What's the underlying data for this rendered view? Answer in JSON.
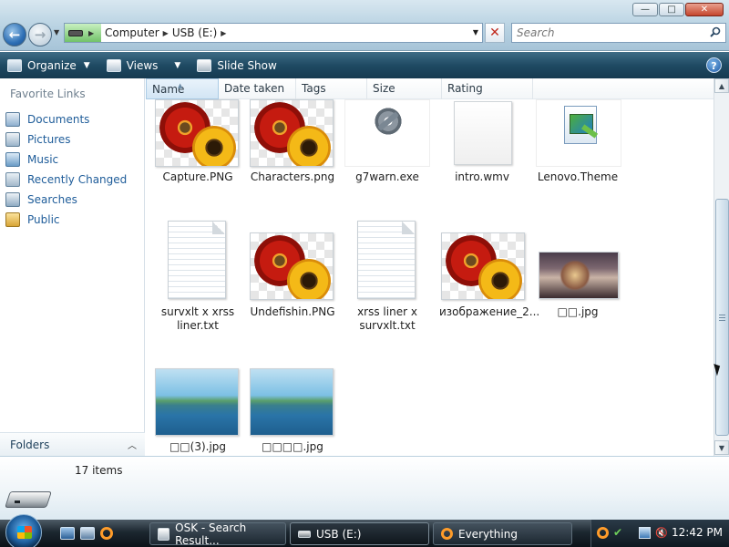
{
  "window": {
    "minimize_label": "—",
    "maximize_label": "□",
    "close_label": "✕"
  },
  "nav": {
    "back_label": "←",
    "forward_label": "→",
    "breadcrumbs": [
      "Computer",
      "USB (E:)"
    ],
    "search_placeholder": "Search"
  },
  "toolbar": {
    "organize_label": "Organize",
    "views_label": "Views",
    "slideshow_label": "Slide Show",
    "help_label": "?"
  },
  "sidebar": {
    "title": "Favorite Links",
    "items": [
      {
        "label": "Documents",
        "icon": "documents-icon"
      },
      {
        "label": "Pictures",
        "icon": "pictures-icon"
      },
      {
        "label": "Music",
        "icon": "music-icon"
      },
      {
        "label": "Recently Changed",
        "icon": "recently-changed-icon"
      },
      {
        "label": "Searches",
        "icon": "searches-icon"
      },
      {
        "label": "Public",
        "icon": "public-folder-icon"
      }
    ],
    "folders_label": "Folders"
  },
  "columns": [
    "Name",
    "Date taken",
    "Tags",
    "Size",
    "Rating"
  ],
  "files": [
    {
      "name": "Capture.PNG",
      "kind": "flower"
    },
    {
      "name": "Characters.png",
      "kind": "flower"
    },
    {
      "name": "g7warn.exe",
      "kind": "exe"
    },
    {
      "name": "intro.wmv",
      "kind": "wmv"
    },
    {
      "name": "Lenovo.Theme",
      "kind": "theme"
    },
    {
      "name": "survxlt x xrss liner.txt",
      "kind": "txt"
    },
    {
      "name": "Undefishin.PNG",
      "kind": "flower"
    },
    {
      "name": "xrss liner x survxlt.txt",
      "kind": "txt"
    },
    {
      "name": "изображение_2...",
      "kind": "flower"
    },
    {
      "name": "□□.jpg",
      "kind": "photo-tree"
    },
    {
      "name": "□□(3).jpg",
      "kind": "photo-landscape"
    },
    {
      "name": "□□□□.jpg",
      "kind": "photo-landscape"
    }
  ],
  "details": {
    "item_count": "17 items"
  },
  "taskbar": {
    "tasks": [
      {
        "label": "OSK - Search Result...",
        "icon": "osk-icon"
      },
      {
        "label": "USB (E:)",
        "icon": "usb-drive-icon"
      },
      {
        "label": "Everything",
        "icon": "everything-search-icon"
      }
    ],
    "clock": "12:42 PM"
  },
  "colors": {
    "toolbar": "#1f4a63",
    "link": "#1e5c99",
    "taskbar": "#1c2730"
  }
}
